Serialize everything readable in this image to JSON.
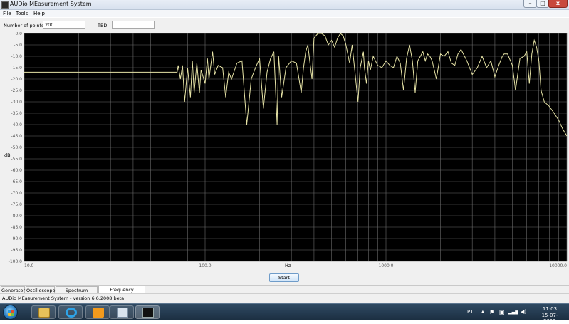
{
  "window": {
    "title": "AUDio MEasurement System",
    "min_glyph": "–",
    "max_glyph": "□",
    "close_glyph": "x"
  },
  "menu": [
    "File",
    "Tools",
    "Help"
  ],
  "controls": {
    "points_label": "Number of points:",
    "points_value": "200",
    "tbd_label": "TBD:",
    "tbd_value": ""
  },
  "colors": {
    "plot_bg": "#000000",
    "grid": "#6b6b6b",
    "trace": "#e6e3a6",
    "axis_text": "#cfcfcf"
  },
  "plot": {
    "y_unit": "dB",
    "x_unit": "Hz",
    "y_ticks": [
      "0.0",
      "-5.0",
      "-10.0",
      "-15.0",
      "-20.0",
      "-25.0",
      "-30.0",
      "-35.0",
      "-40.0",
      "-45.0",
      "-50.0",
      "-55.0",
      "-60.0",
      "-65.0",
      "-70.0",
      "-75.0",
      "-80.0",
      "-85.0",
      "-90.0",
      "-95.0",
      "-100.0"
    ],
    "x_ticks": [
      "10.0",
      "100.0",
      "1000.0",
      "10000.0"
    ]
  },
  "chart_data": {
    "type": "line",
    "x_scale": "log",
    "xlim": [
      10,
      10000
    ],
    "ylim": [
      -100,
      0
    ],
    "xlabel": "Hz",
    "ylabel": "dB",
    "grid": true,
    "series": [
      {
        "x": [
          10,
          50,
          70,
          71,
          73,
          75,
          77,
          80,
          83,
          85,
          87,
          90,
          93,
          95,
          100,
          103,
          105,
          110,
          113,
          118,
          125,
          130,
          135,
          140,
          150,
          160,
          170,
          180,
          190,
          200,
          210,
          220,
          230,
          240,
          250,
          255,
          265,
          280,
          300,
          320,
          340,
          350,
          360,
          370,
          380,
          390,
          400,
          420,
          440,
          460,
          480,
          500,
          520,
          540,
          560,
          580,
          600,
          630,
          650,
          700,
          720,
          750,
          760,
          780,
          800,
          820,
          850,
          900,
          950,
          1000,
          1050,
          1100,
          1150,
          1200,
          1250,
          1300,
          1350,
          1400,
          1450,
          1500,
          1550,
          1600,
          1650,
          1700,
          1750,
          1800,
          1900,
          2000,
          2100,
          2200,
          2300,
          2400,
          2500,
          2600,
          2800,
          3000,
          3200,
          3400,
          3600,
          3800,
          4000,
          4200,
          4400,
          4500,
          4700,
          5000,
          5200,
          5500,
          5800,
          6000,
          6200,
          6400,
          6600,
          6800,
          7000,
          7200,
          7500,
          8000,
          8500,
          9000,
          9500,
          10000
        ],
        "y": [
          -17,
          -17,
          -17,
          -14,
          -20,
          -14,
          -30,
          -15,
          -28,
          -12,
          -26,
          -13,
          -26,
          -16,
          -22,
          -11,
          -20,
          -8,
          -18,
          -14,
          -15,
          -28,
          -17,
          -20,
          -13,
          -12,
          -40,
          -20,
          -15,
          -11,
          -33,
          -17,
          -11,
          -8,
          -40,
          -10,
          -28,
          -15,
          -12,
          -13,
          -26,
          -15,
          -8,
          -5,
          -13,
          -20,
          -2,
          0,
          0,
          -1,
          -5,
          -3,
          -6,
          -2,
          0,
          -1,
          -5,
          -13,
          -5,
          -30,
          -15,
          -8,
          -15,
          -22,
          -12,
          -16,
          -10,
          -14,
          -15,
          -12,
          -14,
          -15,
          -10,
          -13,
          -25,
          -11,
          -5,
          -12,
          -26,
          -12,
          -10,
          -8,
          -12,
          -9,
          -10,
          -12,
          -20,
          -9,
          -10,
          -8,
          -13,
          -14,
          -9,
          -7,
          -12,
          -18,
          -15,
          -10,
          -15,
          -12,
          -19,
          -14,
          -10,
          -9,
          -9,
          -14,
          -25,
          -11,
          -10,
          -8,
          -22,
          -9,
          -3,
          -6,
          -12,
          -25,
          -30,
          -32,
          -35,
          -38,
          -42,
          -45
        ]
      }
    ]
  },
  "start_button": "Start",
  "tabs": [
    "Generator",
    "Oscilloscope",
    "Spectrum Analyzer",
    "Frequency Response"
  ],
  "active_tab": "Frequency Response",
  "status": "AUDio MEasurement System - version 6.6.2008 beta",
  "taskbar": {
    "apps": [
      "windows-explorer",
      "internet-explorer",
      "media-player",
      "window",
      "audio-measurement"
    ],
    "lang": "PT",
    "tray_up": "▲",
    "tray_flag": "⚑",
    "tray_device": "▣",
    "tray_signal": "▂▄▆",
    "tray_volume": "◀)",
    "time": "11:03",
    "date": "15-07-2012"
  }
}
